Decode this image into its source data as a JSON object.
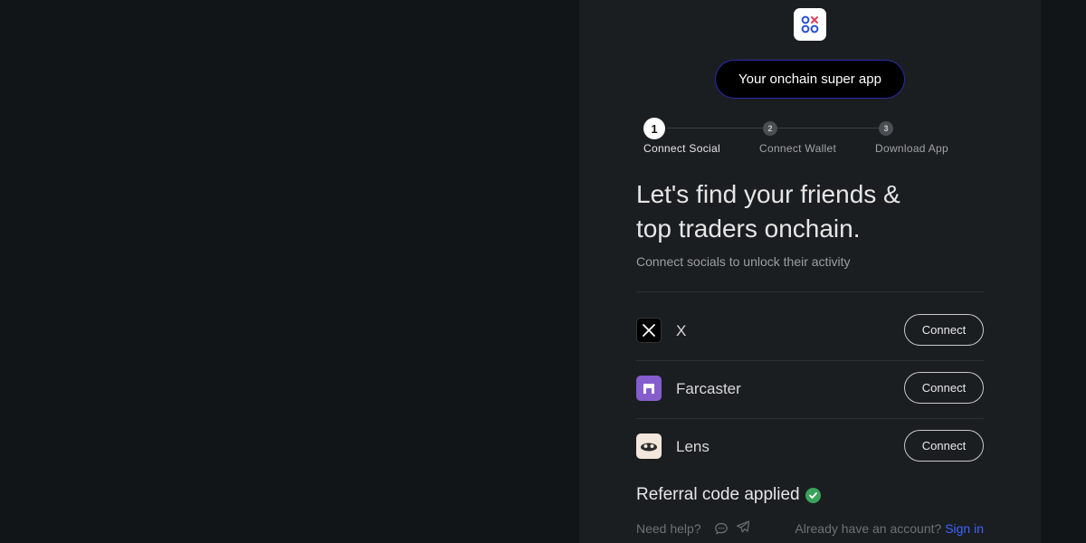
{
  "header": {
    "logo_icon": "app-logo-icon",
    "pill_text": "Your onchain super app"
  },
  "steps": [
    {
      "number": "1",
      "label": "Connect Social",
      "active": true
    },
    {
      "number": "2",
      "label": "Connect Wallet",
      "active": false
    },
    {
      "number": "3",
      "label": "Download App",
      "active": false
    }
  ],
  "main": {
    "headline_line1": "Let's find your friends &",
    "headline_line2": "top traders onchain.",
    "subtext": "Connect socials to unlock their activity"
  },
  "socials": [
    {
      "name": "X",
      "icon": "x-icon",
      "button": "Connect"
    },
    {
      "name": "Farcaster",
      "icon": "farcaster-icon",
      "button": "Connect"
    },
    {
      "name": "Lens",
      "icon": "lens-icon",
      "button": "Connect"
    }
  ],
  "referral": {
    "text": "Referral code applied",
    "icon": "check-circle-icon"
  },
  "footer": {
    "need_help": "Need help?",
    "already": "Already have an account?",
    "signin": "Sign in"
  },
  "colors": {
    "background": "#121518",
    "panel": "#1b1e21",
    "accent_link": "#3b63ff",
    "success": "#3aa35b",
    "farcaster": "#855dcd"
  }
}
